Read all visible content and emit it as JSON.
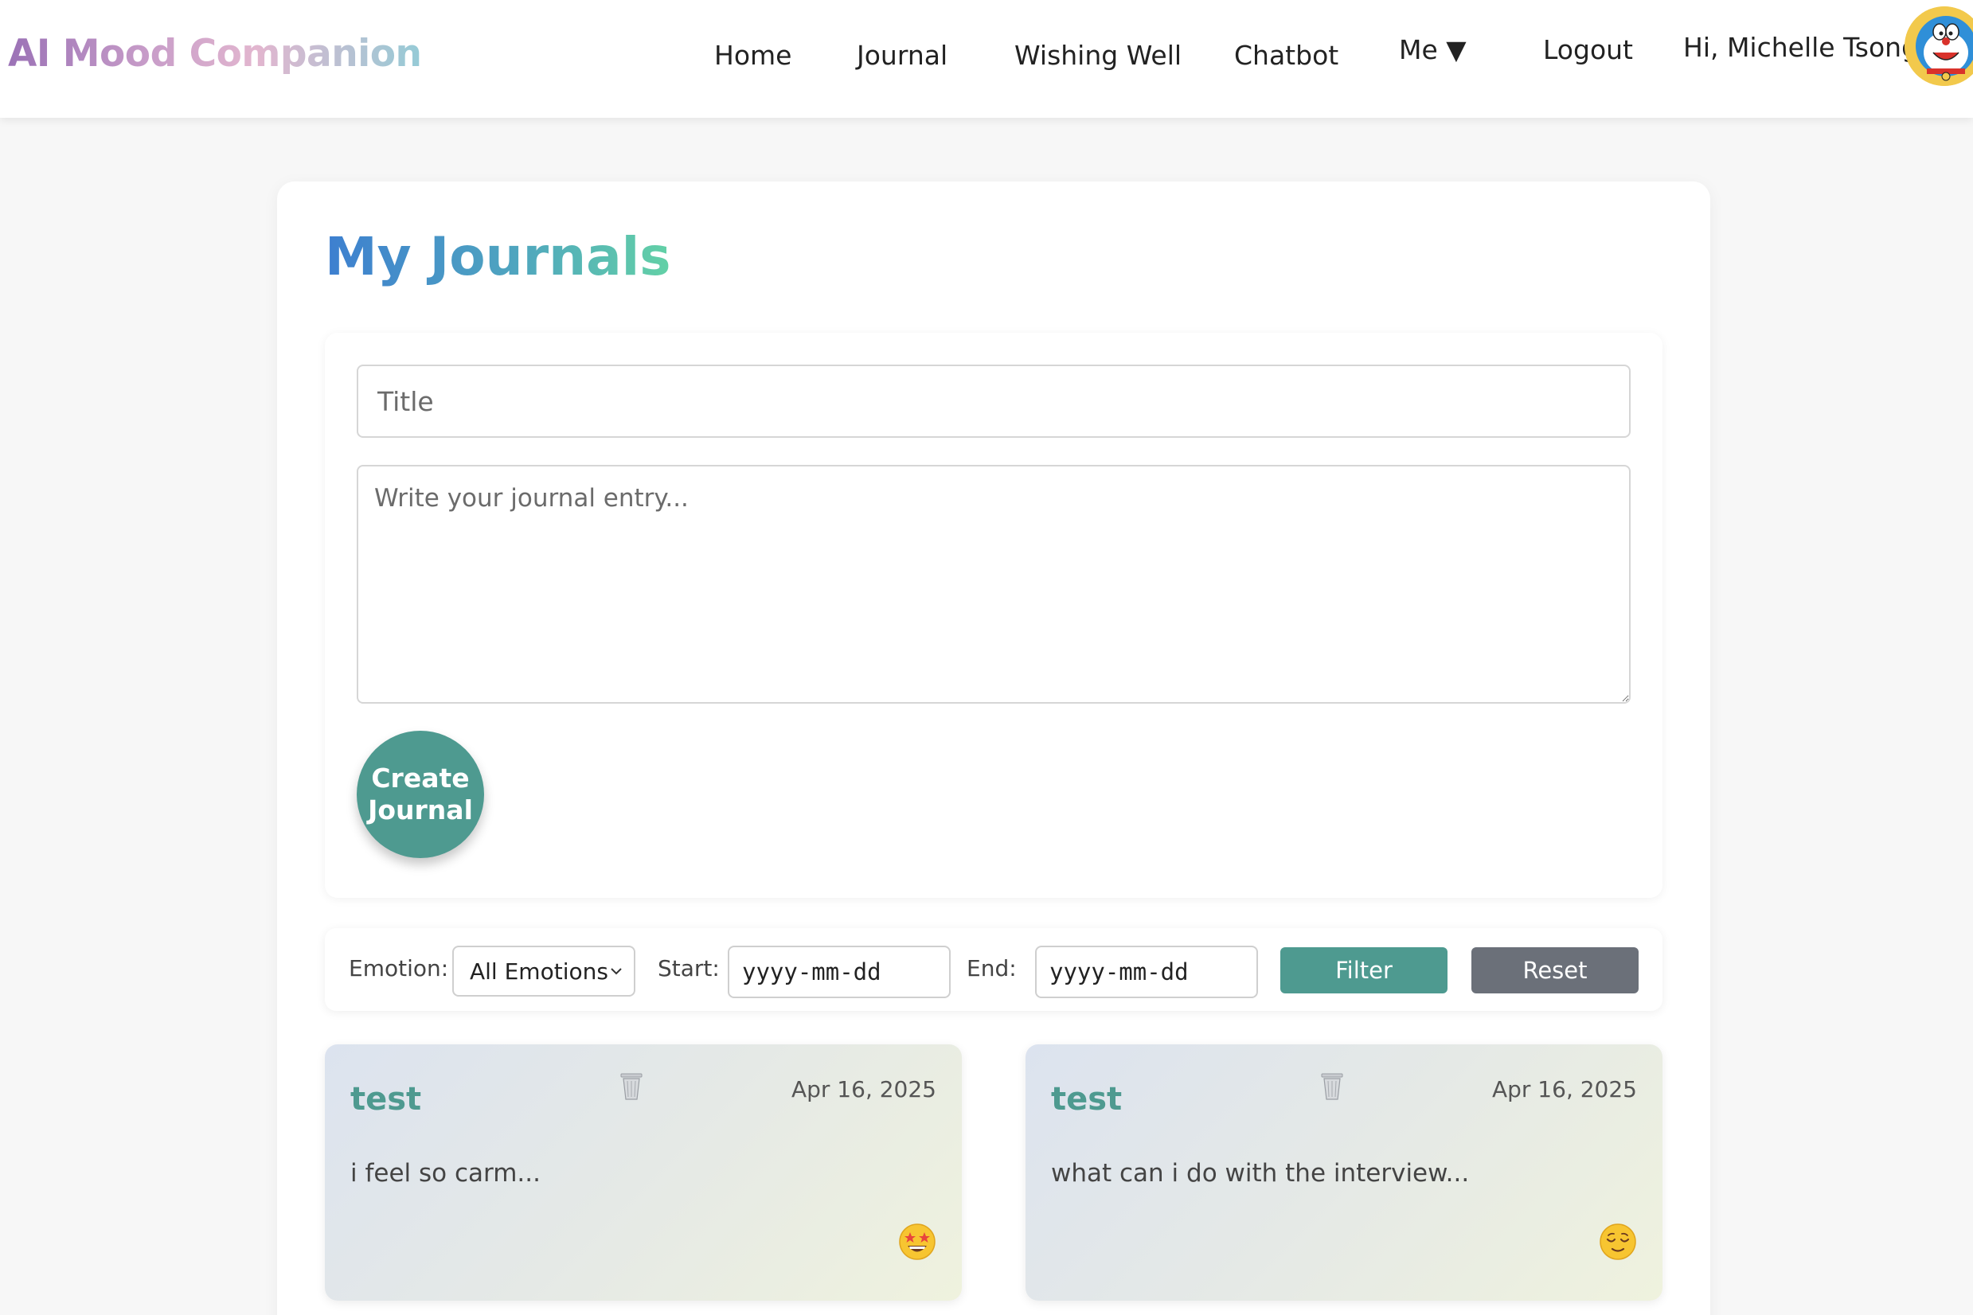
{
  "navbar": {
    "brand": "AI Mood Companion",
    "links": {
      "home": "Home",
      "journal": "Journal",
      "wishing_well": "Wishing Well",
      "chatbot": "Chatbot",
      "me": "Me ▼",
      "logout": "Logout"
    },
    "greeting": "Hi, Michelle Tsong",
    "avatar_icon": "doraemon-avatar"
  },
  "page": {
    "title": "My Journals"
  },
  "form": {
    "title_placeholder": "Title",
    "entry_placeholder": "Write your journal entry...",
    "create_label": "Create Journal"
  },
  "filters": {
    "emotion_label": "Emotion:",
    "emotion_value": "All Emotions",
    "start_label": "Start:",
    "start_value": "yyyy-mm-dd",
    "end_label": "End:",
    "end_value": "yyyy-mm-dd",
    "filter_label": "Filter",
    "reset_label": "Reset"
  },
  "journals": [
    {
      "title": "test",
      "date": "Apr 16, 2025",
      "snippet": "i feel so carm...",
      "emotion_icon": "star-struck-emoji"
    },
    {
      "title": "test",
      "date": "Apr 16, 2025",
      "snippet": "what can i do with the interview...",
      "emotion_icon": "relieved-emoji"
    }
  ],
  "colors": {
    "accent": "#4e9a90",
    "reset": "#6b7079",
    "background": "#f7f7f7"
  }
}
